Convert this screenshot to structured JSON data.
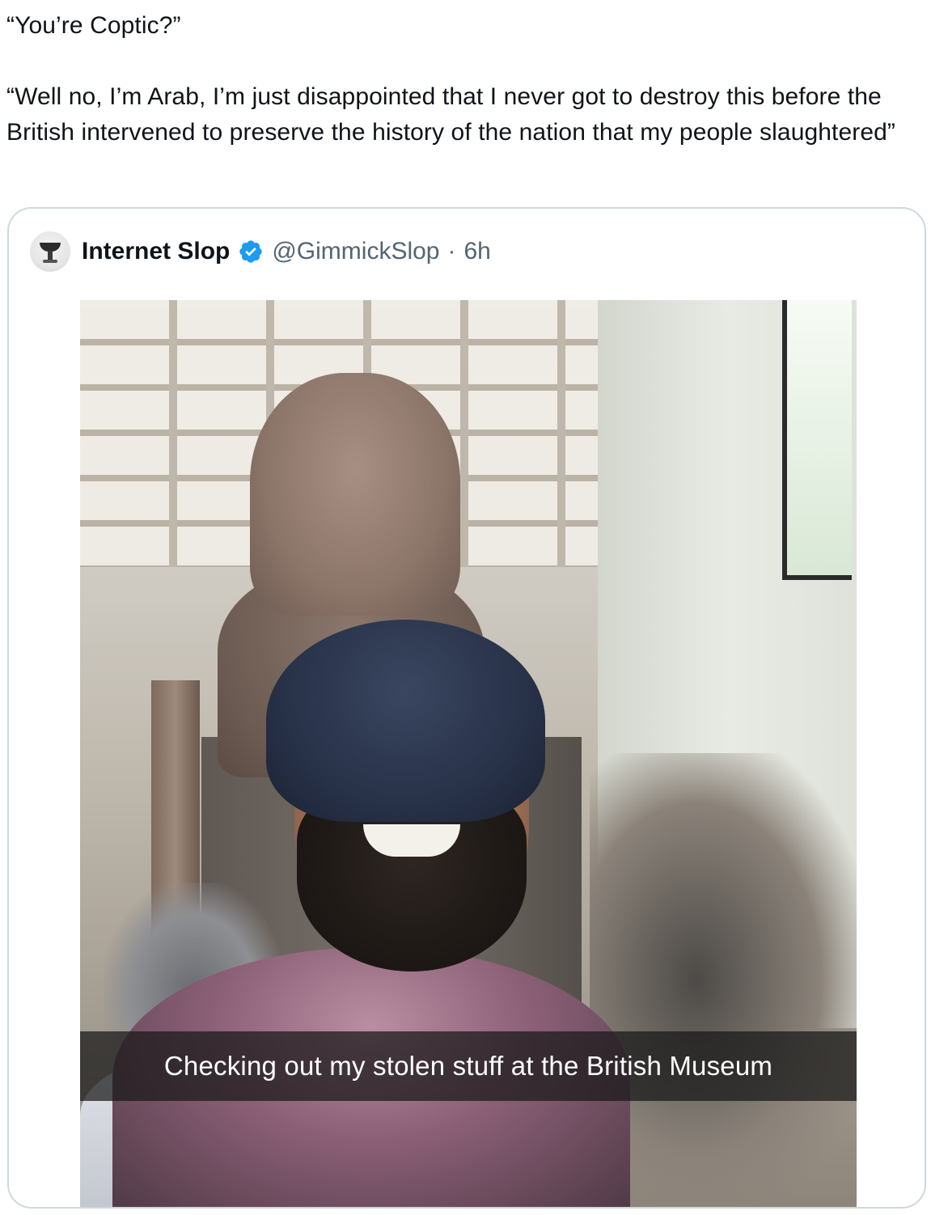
{
  "tweet": {
    "line1": "“You’re Coptic?”",
    "line2": "“Well no, I’m Arab, I’m just disappointed that I never got to destroy this before the British intervened to preserve the history of the nation that my people slaughtered”"
  },
  "quote": {
    "display_name": "Internet Slop",
    "verified_icon": "verified-badge-icon",
    "handle": "@GimmickSlop",
    "separator": "·",
    "time": "6h",
    "media": {
      "caption": "Checking out my stolen stuff at the British Museum"
    }
  },
  "colors": {
    "verified": "#1d9bf0",
    "secondary_text": "#536471",
    "border": "#cfd9de"
  }
}
